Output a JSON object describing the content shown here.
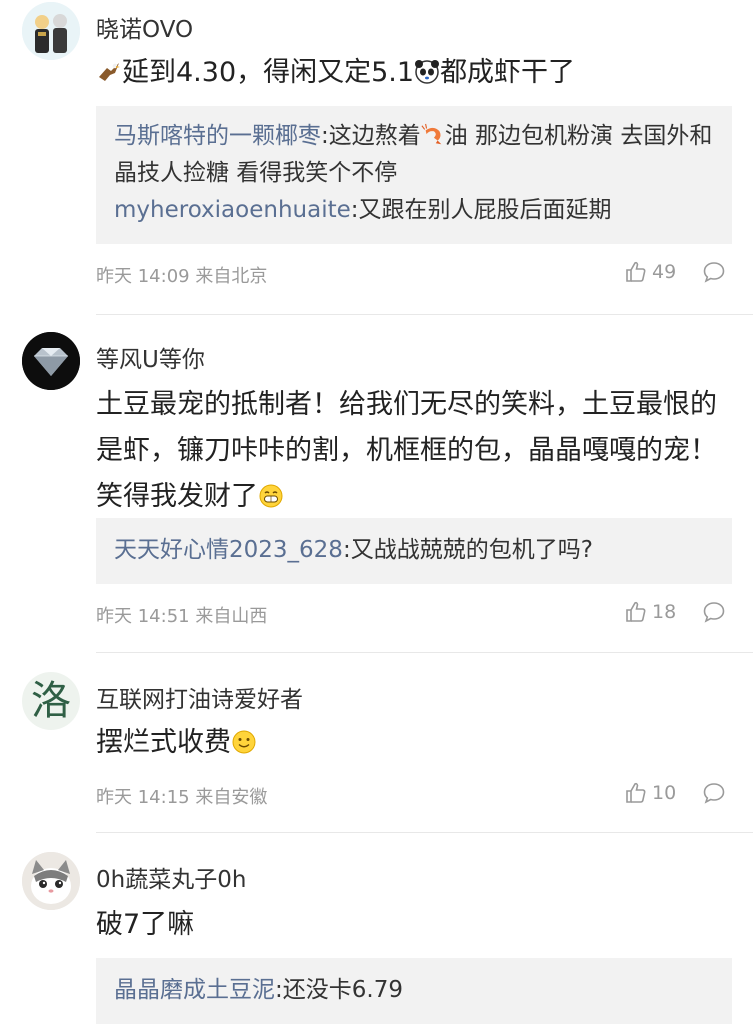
{
  "comments": [
    {
      "username": "晓诺OVO",
      "text_main": "延到4.30，得闲又定5.1",
      "text_tail": "都成虾干了",
      "replies": [
        {
          "name": "马斯喀特的一颗椰枣",
          "sep": ":",
          "pre": "这边熬着",
          "post": "油 那边包机粉演 去国外和晶技人捡糖 看得我笑个不停",
          "icon": "shrimp-emoji-icon"
        },
        {
          "name": "myheroxiaoenhuaite",
          "sep": ":",
          "text": "又跟在别人屁股后面延期"
        }
      ],
      "time": "昨天 14:09 来自北京",
      "likes": "49"
    },
    {
      "username": "等风U等你",
      "text": "土豆最宠的抵制者！给我们无尽的笑料，土豆最恨的是虾，镰刀咔咔的割，机框框的包，晶晶嘎嘎的宠！笑得我发财了",
      "replies": [
        {
          "name": "天天好心情2023_628",
          "sep": ":",
          "text": "又战战兢兢的包机了吗?"
        }
      ],
      "time": "昨天 14:51 来自山西",
      "likes": "18"
    },
    {
      "username": "互联网打油诗爱好者",
      "avatar_char": "洛",
      "text": "摆烂式收费",
      "time": "昨天 14:15 来自安徽",
      "likes": "10"
    },
    {
      "username": "0h蔬菜丸子0h",
      "text": "破7了嘛",
      "replies": [
        {
          "name": "晶晶磨成土豆泥",
          "sep": ":",
          "text": "还没卡6.79"
        }
      ]
    }
  ],
  "icons": {
    "like": "thumbs-up-icon",
    "comment": "comment-bubble-icon",
    "bird_emoji": "eagle-emoji-icon",
    "panda_emoji": "panda-emoji-icon",
    "grin_emoji": "grin-emoji-icon",
    "smile_emoji": "smile-emoji-icon"
  },
  "colors": {
    "reply_name": "#5a6f92",
    "reply_bg": "#f2f2f2",
    "meta": "#9a9a9a"
  }
}
